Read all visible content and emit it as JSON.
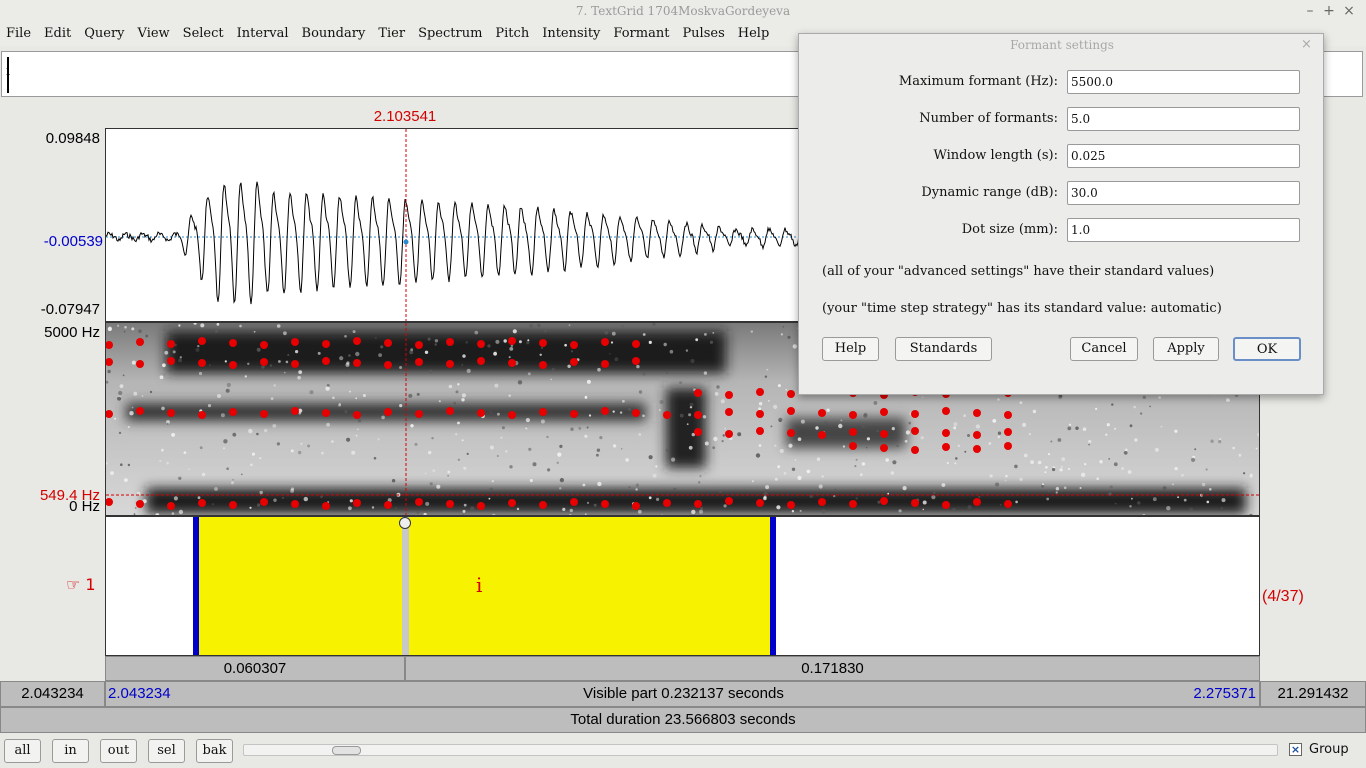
{
  "window": {
    "title": "7. TextGrid 1704MoskvaGordeyeva"
  },
  "menu": [
    "File",
    "Edit",
    "Query",
    "View",
    "Select",
    "Interval",
    "Boundary",
    "Tier",
    "Spectrum",
    "Pitch",
    "Intensity",
    "Formant",
    "Pulses",
    "Help"
  ],
  "editor": {
    "text_value": "i",
    "cursor_time": "2.103541",
    "wave": {
      "max": "0.09848",
      "center": "-0.00539",
      "min": "-0.07947"
    },
    "spectrogram": {
      "max_freq": "5000 Hz",
      "cursor_freq": "549.4 Hz",
      "min_freq": "0 Hz"
    },
    "tier": {
      "number": "☞ 1",
      "label": "i",
      "count": "(4/37)"
    },
    "segments": {
      "left": "0.060307",
      "right": "0.171830"
    },
    "window_start_outer": "2.043234",
    "window_start": "2.043234",
    "visible_part": "Visible part 0.232137 seconds",
    "window_end": "2.275371",
    "remaining": "21.291432",
    "total_duration": "Total duration 23.566803 seconds"
  },
  "bottom_buttons": [
    "all",
    "in",
    "out",
    "sel",
    "bak"
  ],
  "group_label": "Group",
  "formant_dialog": {
    "title": "Formant settings",
    "fields": [
      {
        "label": "Maximum formant (Hz):",
        "value": "5500.0"
      },
      {
        "label": "Number of formants:",
        "value": "5.0"
      },
      {
        "label": "Window length (s):",
        "value": "0.025"
      },
      {
        "label": "Dynamic range (dB):",
        "value": "30.0"
      },
      {
        "label": "Dot size (mm):",
        "value": "1.0"
      }
    ],
    "note_advanced": "(all of your \"advanced settings\" have their standard values)",
    "note_timestep": "(your \"time step strategy\" has its standard value: automatic)",
    "buttons": {
      "help": "Help",
      "standards": "Standards",
      "cancel": "Cancel",
      "apply": "Apply",
      "ok": "OK"
    }
  },
  "colors": {
    "cursor": "#d40000",
    "boundary": "#0000cc",
    "selection": "#f7f200",
    "formant_dot": "#e60000"
  }
}
